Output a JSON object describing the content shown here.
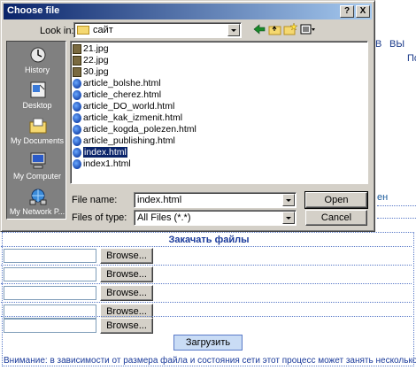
{
  "dialog": {
    "title": "Choose file",
    "help_label": "?",
    "close_label": "X",
    "look_in_label": "Look in:",
    "look_in_value": "сайт",
    "places": [
      {
        "label": "History",
        "icon": "history-icon"
      },
      {
        "label": "Desktop",
        "icon": "desktop-icon"
      },
      {
        "label": "My Documents",
        "icon": "my-documents-icon"
      },
      {
        "label": "My Computer",
        "icon": "my-computer-icon"
      },
      {
        "label": "My Network P...",
        "icon": "network-places-icon"
      }
    ],
    "files": [
      {
        "name": "21.jpg",
        "type": "jpg"
      },
      {
        "name": "22.jpg",
        "type": "jpg"
      },
      {
        "name": "30.jpg",
        "type": "jpg"
      },
      {
        "name": "article_bolshe.html",
        "type": "html"
      },
      {
        "name": "article_cherez.html",
        "type": "html"
      },
      {
        "name": "article_DO_world.html",
        "type": "html"
      },
      {
        "name": "article_kak_izmenit.html",
        "type": "html"
      },
      {
        "name": "article_kogda_polezen.html",
        "type": "html"
      },
      {
        "name": "article_publishing.html",
        "type": "html"
      },
      {
        "name": "index.html",
        "type": "html",
        "selected": true
      },
      {
        "name": "index1.html",
        "type": "html"
      }
    ],
    "file_name_label": "File name:",
    "file_name_value": "index.html",
    "files_of_type_label": "Files of type:",
    "files_of_type_value": "All Files (*.*)",
    "open_label": "Open",
    "cancel_label": "Cancel",
    "colors": {
      "titlebar": "#0a246a",
      "selection": "#0a246a",
      "face": "#d4d0c8"
    }
  },
  "background_page": {
    "toolbar_text_1": "В",
    "toolbar_text_2": "ВЫ",
    "toolbar_text_3": "По",
    "side_text": "ен",
    "upload": {
      "title": "Закачать файлы",
      "browse_label": "Browse...",
      "rows": 5,
      "submit_label": "Загрузить",
      "note": "Внимание: в зависимости от размера файла и состояния сети этот процесс может занять несколько минут."
    }
  }
}
